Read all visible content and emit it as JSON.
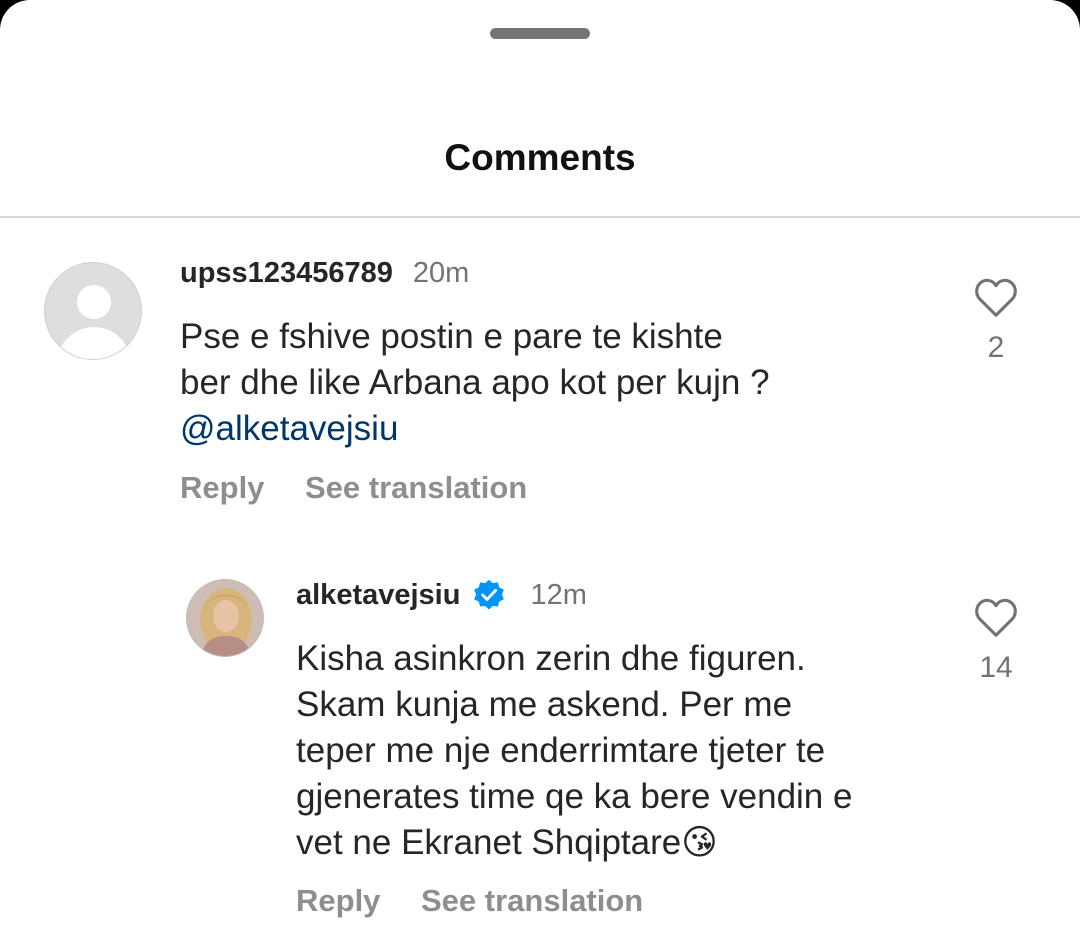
{
  "sheet": {
    "title": "Comments"
  },
  "comments": [
    {
      "username": "upss123456789",
      "time": "20m",
      "lines": [
        "Pse e fshive postin e pare  te kishte",
        "ber dhe like Arbana apo kot per kujn ?"
      ],
      "mention": "@alketavejsiu",
      "reply_label": "Reply",
      "translate_label": "See translation",
      "likes": "2",
      "avatar": "default-avatar"
    },
    {
      "username": "alketavejsiu",
      "verified": true,
      "time": "12m",
      "lines": [
        "Kisha asinkron zerin dhe figuren.",
        "Skam kunja me askend. Per me",
        "teper me nje enderrimtare tjeter te",
        "gjenerates time qe ka bere vendin e",
        "vet ne Ekranet Shqiptare😘"
      ],
      "reply_label": "Reply",
      "translate_label": "See translation",
      "likes": "14",
      "avatar": "profile-photo"
    }
  ],
  "icons": {
    "like": "heart-outline-icon",
    "verified": "verified-badge-icon"
  },
  "colors": {
    "verified_blue": "#0095f6",
    "mention": "#00376b",
    "secondary_text": "#737373"
  }
}
